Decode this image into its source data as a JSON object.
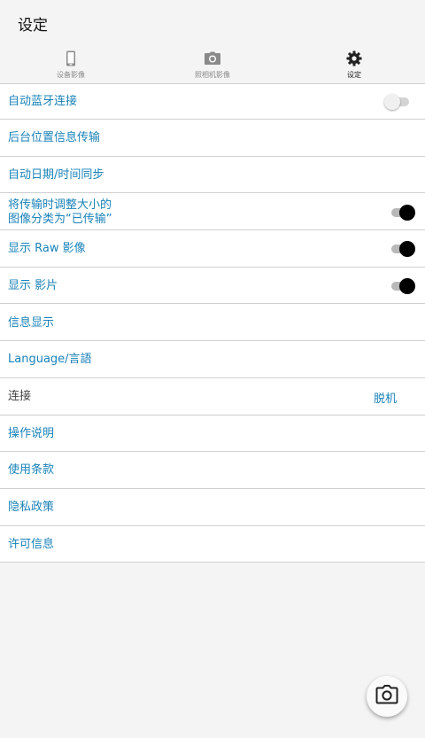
{
  "header": {
    "title": "设定"
  },
  "tabs": [
    {
      "label": "设备影像",
      "icon": "phone-icon"
    },
    {
      "label": "照相机影像",
      "icon": "camera-icon"
    },
    {
      "label": "设定",
      "icon": "gear-icon"
    }
  ],
  "settings": {
    "auto_bluetooth": {
      "label": "自动蓝牙连接",
      "toggle": "off"
    },
    "background_location": {
      "label": "后台位置信息传输"
    },
    "auto_datetime": {
      "label": "自动日期/时间同步"
    },
    "resize_transfer": {
      "label_line1": "将传输时调整大小的",
      "label_line2": "图像分类为“已传输”",
      "toggle": "on"
    },
    "show_raw": {
      "label": "显示 Raw 影像",
      "toggle": "on"
    },
    "show_movie": {
      "label": "显示 影片",
      "toggle": "on"
    },
    "info_display": {
      "label": "信息显示"
    },
    "language": {
      "label": "Language/言語"
    },
    "connection": {
      "label": "连接",
      "value": "脱机"
    },
    "manual": {
      "label": "操作说明"
    },
    "terms": {
      "label": "使用条款"
    },
    "privacy": {
      "label": "隐私政策"
    },
    "license": {
      "label": "许可信息"
    }
  },
  "fab": {
    "icon": "camera-icon"
  },
  "colors": {
    "accent": "#1a82b8",
    "background": "#f4f4f4",
    "divider": "#cfcfcf"
  }
}
